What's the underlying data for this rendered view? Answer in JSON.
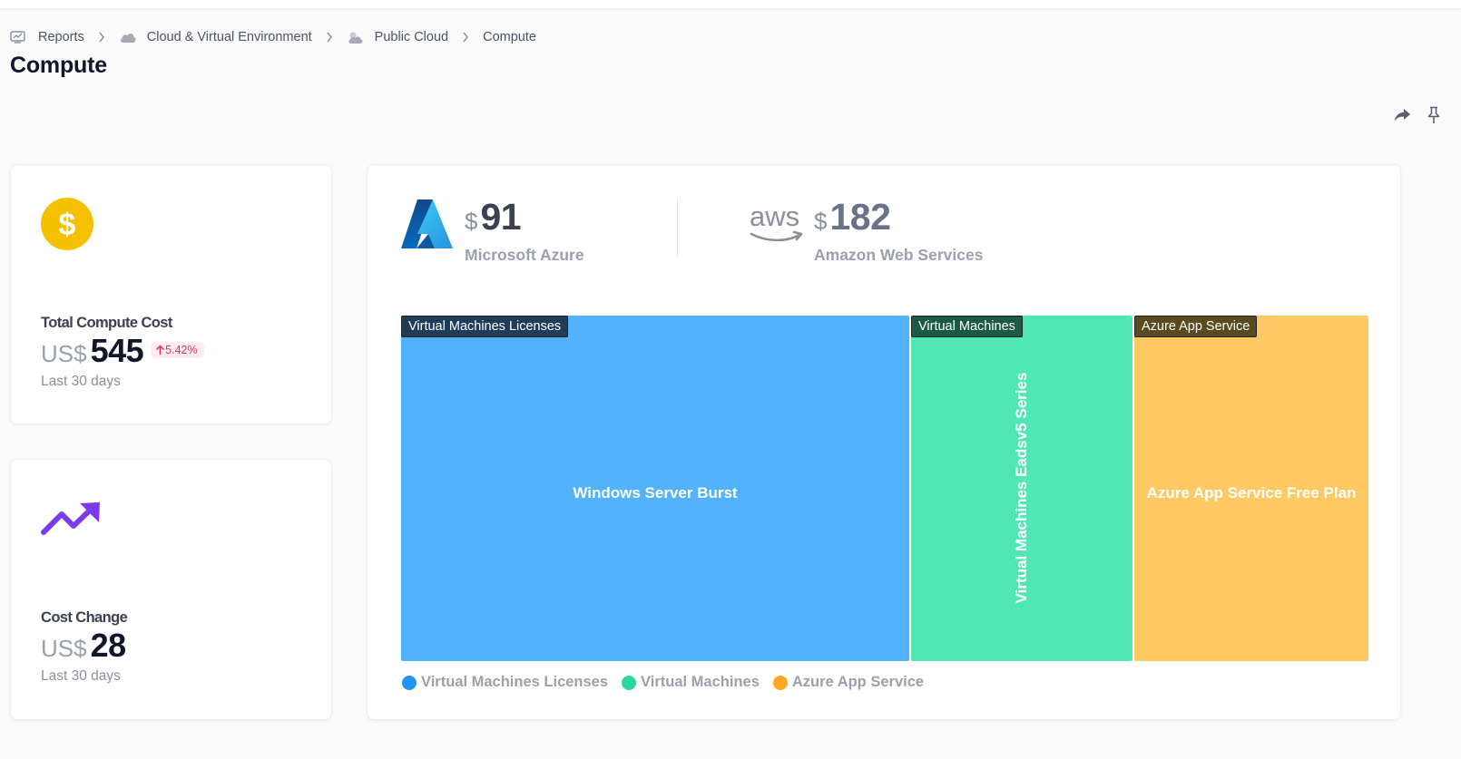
{
  "breadcrumb": {
    "items": [
      {
        "label": "Reports",
        "icon": "reports-icon"
      },
      {
        "label": "Cloud & Virtual Environment",
        "icon": "cloud-icon"
      },
      {
        "label": "Public Cloud",
        "icon": "public-cloud-icon"
      },
      {
        "label": "Compute"
      }
    ]
  },
  "page": {
    "title": "Compute"
  },
  "actions": {
    "share_icon": "share-icon",
    "pin_icon": "pin-icon"
  },
  "kpis": {
    "total": {
      "label": "Total Compute Cost",
      "currency": "US$",
      "value": "545",
      "change": "5.42%",
      "period": "Last 30 days",
      "icon": "dollar-icon",
      "icon_color": "#f5c000"
    },
    "change": {
      "label": "Cost Change",
      "currency": "US$",
      "value": "28",
      "period": "Last 30 days",
      "icon": "trending-up-icon",
      "icon_color": "#7c3aed"
    }
  },
  "providers": [
    {
      "name": "Microsoft Azure",
      "currency": "$",
      "amount": "91",
      "logo": "azure-logo",
      "amount_color": "#3b4152"
    },
    {
      "name": "Amazon Web Services",
      "currency": "$",
      "amount": "182",
      "logo": "aws-logo",
      "amount_color": "#6b7287"
    }
  ],
  "chart_data": {
    "type": "treemap",
    "groups": [
      {
        "name": "Virtual Machines Licenses",
        "color": "#52b2fb",
        "header_color": "#1f3d5a",
        "leaves": [
          {
            "name": "Windows Server Burst"
          }
        ]
      },
      {
        "name": "Virtual Machines",
        "color": "#4fe8b4",
        "header_color": "#1d5a45",
        "leaves": [
          {
            "name": "Virtual Machines Eadsv5 Series"
          }
        ]
      },
      {
        "name": "Azure App Service",
        "color": "#fec963",
        "header_color": "#5a4a1f",
        "leaves": [
          {
            "name": "Azure App Service Free Plan"
          }
        ]
      }
    ],
    "legend": [
      {
        "name": "Virtual Machines Licenses",
        "color": "#2394f5"
      },
      {
        "name": "Virtual Machines",
        "color": "#2bd79d"
      },
      {
        "name": "Azure App Service",
        "color": "#fea923"
      }
    ]
  }
}
